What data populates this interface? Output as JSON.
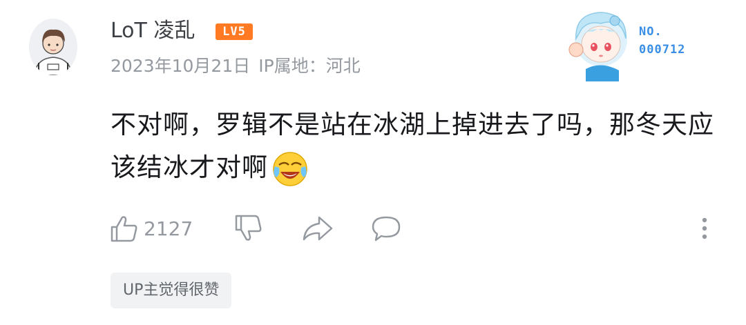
{
  "user": {
    "name": "LoT 凌乱",
    "level": "LV5",
    "avatar_icon": "boy-avatar-icon"
  },
  "meta": {
    "date": "2023年10月21日",
    "ip_location": "IP属地：河北"
  },
  "decoration": {
    "number_label": "NO.",
    "number": "000712"
  },
  "comment": {
    "text": "不对啊，罗辑不是站在冰湖上掉进去了吗，那冬天应该结冰才对啊",
    "emoji": "laugh-cry-emoji"
  },
  "actions": {
    "like_count": "2127",
    "icons": [
      "thumbs-up-icon",
      "thumbs-down-icon",
      "share-icon",
      "reply-icon",
      "more-icon"
    ]
  },
  "up_tag": "UP主觉得很赞",
  "colors": {
    "level_badge": "#ff7a22",
    "meta_text": "#9499a0",
    "deco_number": "#3b8ee6"
  }
}
